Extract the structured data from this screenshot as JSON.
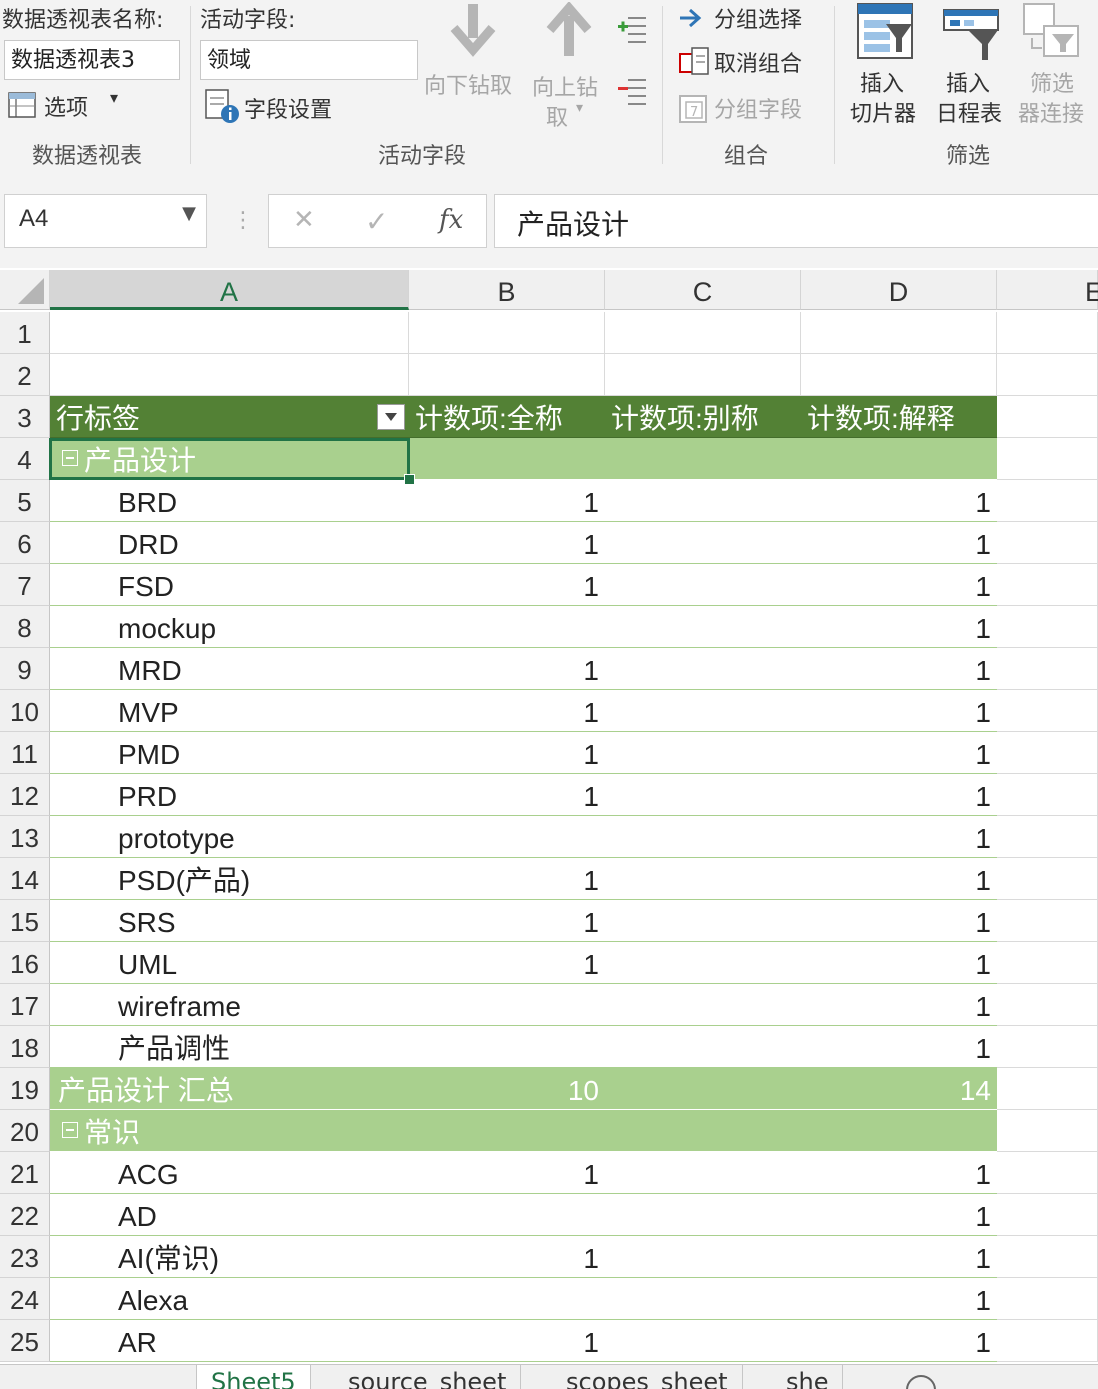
{
  "ribbon": {
    "pivot_name_label": "数据透视表名称:",
    "pivot_name_value": "数据透视表3",
    "options_label": "选项",
    "group_pivot_label": "数据透视表",
    "active_field_label": "活动字段:",
    "active_field_value": "领域",
    "field_settings_label": "字段设置",
    "drill_down_label": "向下钻取",
    "drill_up_label_1": "向上钻",
    "drill_up_label_2": "取",
    "group_active_field_label": "活动字段",
    "group_selection_label": "分组选择",
    "ungroup_label": "取消组合",
    "group_field_label": "分组字段",
    "group_group_label": "组合",
    "insert_slicer_1": "插入",
    "insert_slicer_2": "切片器",
    "insert_timeline_1": "插入",
    "insert_timeline_2": "日程表",
    "filter_conn_1": "筛选",
    "filter_conn_2": "器连接",
    "group_filter_label": "筛选"
  },
  "formula_bar": {
    "name_box": "A4",
    "cancel": "✕",
    "enter": "✓",
    "fx": "fx",
    "content": "产品设计"
  },
  "columns": [
    "A",
    "B",
    "C",
    "D",
    "E"
  ],
  "rows": [
    {
      "n": "1",
      "kind": "empty",
      "a": "",
      "b": "",
      "c": "",
      "d": ""
    },
    {
      "n": "2",
      "kind": "empty",
      "a": "",
      "b": "",
      "c": "",
      "d": ""
    },
    {
      "n": "3",
      "kind": "hdr3",
      "a": "行标签",
      "b": "计数项:全称",
      "c": "计数项:别称",
      "d": "计数项:解释"
    },
    {
      "n": "4",
      "kind": "grp",
      "a": "产品设计",
      "b": "",
      "c": "",
      "d": ""
    },
    {
      "n": "5",
      "kind": "item",
      "a": "BRD",
      "b": "1",
      "c": "",
      "d": "1"
    },
    {
      "n": "6",
      "kind": "item",
      "a": "DRD",
      "b": "1",
      "c": "",
      "d": "1"
    },
    {
      "n": "7",
      "kind": "item",
      "a": "FSD",
      "b": "1",
      "c": "",
      "d": "1"
    },
    {
      "n": "8",
      "kind": "item",
      "a": "mockup",
      "b": "",
      "c": "",
      "d": "1"
    },
    {
      "n": "9",
      "kind": "item",
      "a": "MRD",
      "b": "1",
      "c": "",
      "d": "1"
    },
    {
      "n": "10",
      "kind": "item",
      "a": "MVP",
      "b": "1",
      "c": "",
      "d": "1"
    },
    {
      "n": "11",
      "kind": "item",
      "a": "PMD",
      "b": "1",
      "c": "",
      "d": "1"
    },
    {
      "n": "12",
      "kind": "item",
      "a": "PRD",
      "b": "1",
      "c": "",
      "d": "1"
    },
    {
      "n": "13",
      "kind": "item",
      "a": "prototype",
      "b": "",
      "c": "",
      "d": "1"
    },
    {
      "n": "14",
      "kind": "item",
      "a": "PSD(产品)",
      "b": "1",
      "c": "",
      "d": "1"
    },
    {
      "n": "15",
      "kind": "item",
      "a": "SRS",
      "b": "1",
      "c": "",
      "d": "1"
    },
    {
      "n": "16",
      "kind": "item",
      "a": "UML",
      "b": "1",
      "c": "",
      "d": "1"
    },
    {
      "n": "17",
      "kind": "item",
      "a": "wireframe",
      "b": "",
      "c": "",
      "d": "1"
    },
    {
      "n": "18",
      "kind": "item",
      "a": "产品调性",
      "b": "",
      "c": "",
      "d": "1"
    },
    {
      "n": "19",
      "kind": "sub",
      "a": "产品设计 汇总",
      "b": "10",
      "c": "",
      "d": "14"
    },
    {
      "n": "20",
      "kind": "grp",
      "a": "常识",
      "b": "",
      "c": "",
      "d": ""
    },
    {
      "n": "21",
      "kind": "item",
      "a": "ACG",
      "b": "1",
      "c": "",
      "d": "1"
    },
    {
      "n": "22",
      "kind": "item",
      "a": "AD",
      "b": "",
      "c": "",
      "d": "1"
    },
    {
      "n": "23",
      "kind": "item",
      "a": "AI(常识)",
      "b": "1",
      "c": "",
      "d": "1"
    },
    {
      "n": "24",
      "kind": "item",
      "a": "Alexa",
      "b": "",
      "c": "",
      "d": "1"
    },
    {
      "n": "25",
      "kind": "item",
      "a": "AR",
      "b": "1",
      "c": "",
      "d": "1"
    }
  ],
  "sheet_tabs": [
    "Sheet5",
    "source_sheet",
    "scopes_sheet",
    "she"
  ],
  "colors": {
    "accent": "#217346",
    "pivot_header": "#538135",
    "pivot_group": "#a9d08e"
  }
}
